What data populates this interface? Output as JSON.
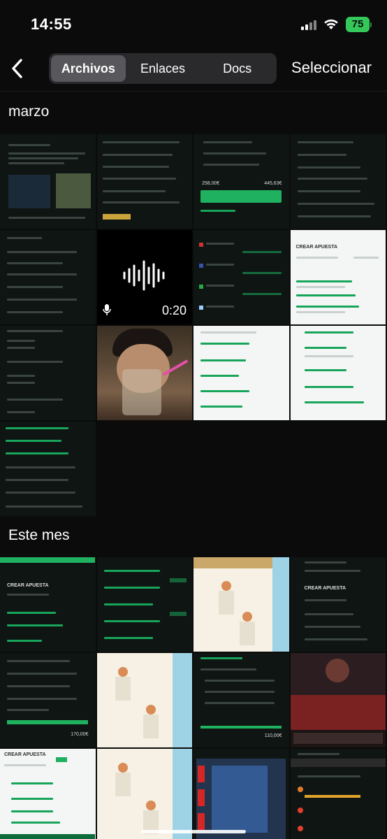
{
  "status": {
    "time": "14:55",
    "battery": "75"
  },
  "nav": {
    "tabs": [
      {
        "label": "Archivos",
        "active": true
      },
      {
        "label": "Enlaces",
        "active": false
      },
      {
        "label": "Docs",
        "active": false
      }
    ],
    "select_label": "Seleccionar"
  },
  "sections": [
    {
      "title": "marzo",
      "items": [
        {
          "kind": "screenshot",
          "theme": "dark",
          "label": "tweet-screenshot"
        },
        {
          "kind": "screenshot",
          "theme": "dark",
          "label": "bet-slip-screenshot",
          "text": "258,00€"
        },
        {
          "kind": "screenshot",
          "theme": "dark",
          "label": "bet-slip-screenshot",
          "text": "445,63€"
        },
        {
          "kind": "screenshot",
          "theme": "dark",
          "label": "bet-list-screenshot"
        },
        {
          "kind": "screenshot",
          "theme": "dark",
          "label": "cards-market-screenshot"
        },
        {
          "kind": "voice-note",
          "duration": "0:20"
        },
        {
          "kind": "screenshot",
          "theme": "dark",
          "label": "odds-table-screenshot"
        },
        {
          "kind": "screenshot",
          "theme": "light",
          "label": "crear-apuesta-screenshot",
          "text": "CREAR APUESTA"
        },
        {
          "kind": "screenshot",
          "theme": "dark",
          "label": "exact-score-screenshot"
        },
        {
          "kind": "photo",
          "label": "selfie-photo"
        },
        {
          "kind": "screenshot",
          "theme": "light",
          "label": "player-props-screenshot"
        },
        {
          "kind": "screenshot",
          "theme": "light",
          "label": "player-props-screenshot"
        },
        {
          "kind": "screenshot",
          "theme": "dark",
          "label": "bet-builder-screenshot"
        }
      ]
    },
    {
      "title": "Este mes",
      "items": [
        {
          "kind": "screenshot",
          "theme": "dark",
          "label": "bet-slip-screenshot",
          "text": "CREAR APUESTA"
        },
        {
          "kind": "screenshot",
          "theme": "dark",
          "label": "bet-builder-screenshot"
        },
        {
          "kind": "image",
          "label": "cartoon-image"
        },
        {
          "kind": "screenshot",
          "theme": "dark",
          "label": "nba-props-screenshot",
          "text": "CREAR APUESTA"
        },
        {
          "kind": "screenshot",
          "theme": "dark",
          "label": "bet-slip-screenshot",
          "text": "170,00€"
        },
        {
          "kind": "image",
          "label": "cartoon-image"
        },
        {
          "kind": "screenshot",
          "theme": "dark",
          "label": "bet-slip-screenshot",
          "text": "110,00€"
        },
        {
          "kind": "image",
          "label": "live-stream-screenshot"
        },
        {
          "kind": "screenshot",
          "theme": "light",
          "label": "crear-apuesta-screenshot",
          "text": "CREAR APUESTA"
        },
        {
          "kind": "image",
          "label": "cartoon-image"
        },
        {
          "kind": "screenshot",
          "theme": "dark",
          "label": "game-board-screenshot"
        },
        {
          "kind": "screenshot",
          "theme": "dark",
          "label": "player-list-screenshot"
        }
      ]
    }
  ]
}
